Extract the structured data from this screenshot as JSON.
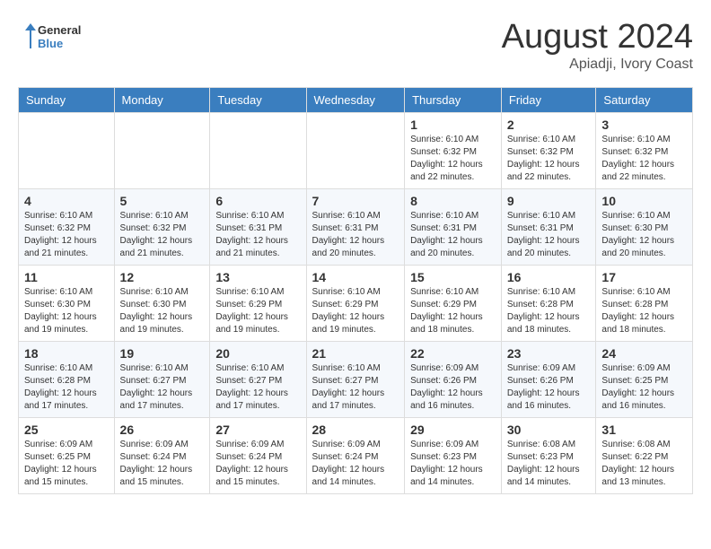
{
  "header": {
    "logo_general": "General",
    "logo_blue": "Blue",
    "month_year": "August 2024",
    "location": "Apiadji, Ivory Coast"
  },
  "weekdays": [
    "Sunday",
    "Monday",
    "Tuesday",
    "Wednesday",
    "Thursday",
    "Friday",
    "Saturday"
  ],
  "weeks": [
    [
      {
        "day": "",
        "info": ""
      },
      {
        "day": "",
        "info": ""
      },
      {
        "day": "",
        "info": ""
      },
      {
        "day": "",
        "info": ""
      },
      {
        "day": "1",
        "info": "Sunrise: 6:10 AM\nSunset: 6:32 PM\nDaylight: 12 hours\nand 22 minutes."
      },
      {
        "day": "2",
        "info": "Sunrise: 6:10 AM\nSunset: 6:32 PM\nDaylight: 12 hours\nand 22 minutes."
      },
      {
        "day": "3",
        "info": "Sunrise: 6:10 AM\nSunset: 6:32 PM\nDaylight: 12 hours\nand 22 minutes."
      }
    ],
    [
      {
        "day": "4",
        "info": "Sunrise: 6:10 AM\nSunset: 6:32 PM\nDaylight: 12 hours\nand 21 minutes."
      },
      {
        "day": "5",
        "info": "Sunrise: 6:10 AM\nSunset: 6:32 PM\nDaylight: 12 hours\nand 21 minutes."
      },
      {
        "day": "6",
        "info": "Sunrise: 6:10 AM\nSunset: 6:31 PM\nDaylight: 12 hours\nand 21 minutes."
      },
      {
        "day": "7",
        "info": "Sunrise: 6:10 AM\nSunset: 6:31 PM\nDaylight: 12 hours\nand 20 minutes."
      },
      {
        "day": "8",
        "info": "Sunrise: 6:10 AM\nSunset: 6:31 PM\nDaylight: 12 hours\nand 20 minutes."
      },
      {
        "day": "9",
        "info": "Sunrise: 6:10 AM\nSunset: 6:31 PM\nDaylight: 12 hours\nand 20 minutes."
      },
      {
        "day": "10",
        "info": "Sunrise: 6:10 AM\nSunset: 6:30 PM\nDaylight: 12 hours\nand 20 minutes."
      }
    ],
    [
      {
        "day": "11",
        "info": "Sunrise: 6:10 AM\nSunset: 6:30 PM\nDaylight: 12 hours\nand 19 minutes."
      },
      {
        "day": "12",
        "info": "Sunrise: 6:10 AM\nSunset: 6:30 PM\nDaylight: 12 hours\nand 19 minutes."
      },
      {
        "day": "13",
        "info": "Sunrise: 6:10 AM\nSunset: 6:29 PM\nDaylight: 12 hours\nand 19 minutes."
      },
      {
        "day": "14",
        "info": "Sunrise: 6:10 AM\nSunset: 6:29 PM\nDaylight: 12 hours\nand 19 minutes."
      },
      {
        "day": "15",
        "info": "Sunrise: 6:10 AM\nSunset: 6:29 PM\nDaylight: 12 hours\nand 18 minutes."
      },
      {
        "day": "16",
        "info": "Sunrise: 6:10 AM\nSunset: 6:28 PM\nDaylight: 12 hours\nand 18 minutes."
      },
      {
        "day": "17",
        "info": "Sunrise: 6:10 AM\nSunset: 6:28 PM\nDaylight: 12 hours\nand 18 minutes."
      }
    ],
    [
      {
        "day": "18",
        "info": "Sunrise: 6:10 AM\nSunset: 6:28 PM\nDaylight: 12 hours\nand 17 minutes."
      },
      {
        "day": "19",
        "info": "Sunrise: 6:10 AM\nSunset: 6:27 PM\nDaylight: 12 hours\nand 17 minutes."
      },
      {
        "day": "20",
        "info": "Sunrise: 6:10 AM\nSunset: 6:27 PM\nDaylight: 12 hours\nand 17 minutes."
      },
      {
        "day": "21",
        "info": "Sunrise: 6:10 AM\nSunset: 6:27 PM\nDaylight: 12 hours\nand 17 minutes."
      },
      {
        "day": "22",
        "info": "Sunrise: 6:09 AM\nSunset: 6:26 PM\nDaylight: 12 hours\nand 16 minutes."
      },
      {
        "day": "23",
        "info": "Sunrise: 6:09 AM\nSunset: 6:26 PM\nDaylight: 12 hours\nand 16 minutes."
      },
      {
        "day": "24",
        "info": "Sunrise: 6:09 AM\nSunset: 6:25 PM\nDaylight: 12 hours\nand 16 minutes."
      }
    ],
    [
      {
        "day": "25",
        "info": "Sunrise: 6:09 AM\nSunset: 6:25 PM\nDaylight: 12 hours\nand 15 minutes."
      },
      {
        "day": "26",
        "info": "Sunrise: 6:09 AM\nSunset: 6:24 PM\nDaylight: 12 hours\nand 15 minutes."
      },
      {
        "day": "27",
        "info": "Sunrise: 6:09 AM\nSunset: 6:24 PM\nDaylight: 12 hours\nand 15 minutes."
      },
      {
        "day": "28",
        "info": "Sunrise: 6:09 AM\nSunset: 6:24 PM\nDaylight: 12 hours\nand 14 minutes."
      },
      {
        "day": "29",
        "info": "Sunrise: 6:09 AM\nSunset: 6:23 PM\nDaylight: 12 hours\nand 14 minutes."
      },
      {
        "day": "30",
        "info": "Sunrise: 6:08 AM\nSunset: 6:23 PM\nDaylight: 12 hours\nand 14 minutes."
      },
      {
        "day": "31",
        "info": "Sunrise: 6:08 AM\nSunset: 6:22 PM\nDaylight: 12 hours\nand 13 minutes."
      }
    ]
  ]
}
